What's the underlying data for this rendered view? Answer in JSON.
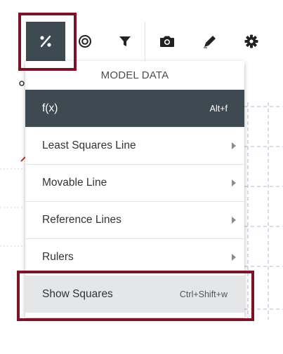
{
  "toolbar": {
    "buttons": [
      {
        "name": "model-data",
        "icon": "percent-icon",
        "active": true
      },
      {
        "name": "measure",
        "icon": "target-icon",
        "active": false
      },
      {
        "name": "filter",
        "icon": "funnel-icon",
        "active": false
      },
      {
        "name": "camera",
        "icon": "camera-icon",
        "active": false
      },
      {
        "name": "pencil",
        "icon": "pencil-icon",
        "active": false
      },
      {
        "name": "settings",
        "icon": "gear-icon",
        "active": false
      }
    ]
  },
  "menu": {
    "header": "MODEL DATA",
    "items": [
      {
        "label": "f(x)",
        "shortcut": "Alt+f",
        "submenu": false,
        "state": "selected"
      },
      {
        "label": "Least Squares Line",
        "shortcut": "",
        "submenu": true,
        "state": "normal"
      },
      {
        "label": "Movable Line",
        "shortcut": "",
        "submenu": true,
        "state": "normal"
      },
      {
        "label": "Reference Lines",
        "shortcut": "",
        "submenu": true,
        "state": "normal"
      },
      {
        "label": "Rulers",
        "shortcut": "",
        "submenu": true,
        "state": "normal"
      },
      {
        "label": "Show Squares",
        "shortcut": "Ctrl+Shift+w",
        "submenu": false,
        "state": "hovered"
      }
    ]
  },
  "colors": {
    "active_bg": "#3d4a52",
    "highlight_border": "#7b1525",
    "hover_bg": "#e4e6e8",
    "grid_line": "#b9b3d6"
  }
}
